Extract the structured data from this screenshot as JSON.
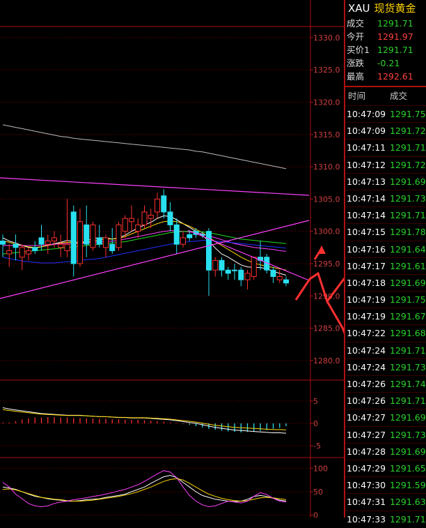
{
  "header": {
    "symbol": "XAU",
    "name": "现货黄金"
  },
  "quote": [
    {
      "label": "成交",
      "value": "1291.71",
      "color": "#2bd32b"
    },
    {
      "label": "今开",
      "value": "1291.97",
      "color": "#ff4040"
    },
    {
      "label": "买价1",
      "value": "1291.71",
      "color": "#2bd32b"
    },
    {
      "label": "涨跌",
      "value": "-0.21",
      "color": "#2bd32b"
    },
    {
      "label": "最高",
      "value": "1292.61",
      "color": "#ff4040"
    }
  ],
  "ticks_header": {
    "time": "时间",
    "price": "成交"
  },
  "ticks": [
    {
      "time": "10:47:09",
      "price": "1291.75"
    },
    {
      "time": "10:47:09",
      "price": "1291.72"
    },
    {
      "time": "10:47:11",
      "price": "1291.71"
    },
    {
      "time": "10:47:12",
      "price": "1291.72"
    },
    {
      "time": "10:47:13",
      "price": "1291.69"
    },
    {
      "time": "10:47:14",
      "price": "1291.73"
    },
    {
      "time": "10:47:14",
      "price": "1291.71"
    },
    {
      "time": "10:47:15",
      "price": "1291.78"
    },
    {
      "time": "10:47:16",
      "price": "1291.64"
    },
    {
      "time": "10:47:17",
      "price": "1291.61"
    },
    {
      "time": "10:47:18",
      "price": "1291.69"
    },
    {
      "time": "10:47:19",
      "price": "1291.75"
    },
    {
      "time": "10:47:19",
      "price": "1291.67"
    },
    {
      "time": "10:47:22",
      "price": "1291.68"
    },
    {
      "time": "10:47:24",
      "price": "1291.71"
    },
    {
      "time": "10:47:24",
      "price": "1291.73"
    },
    {
      "time": "10:47:26",
      "price": "1291.74"
    },
    {
      "time": "10:47:26",
      "price": "1291.71"
    },
    {
      "time": "10:47:27",
      "price": "1291.69"
    },
    {
      "time": "10:47:27",
      "price": "1291.73"
    },
    {
      "time": "10:47:28",
      "price": "1291.69"
    },
    {
      "time": "10:47:29",
      "price": "1291.65"
    },
    {
      "time": "10:47:30",
      "price": "1291.59"
    },
    {
      "time": "10:47:31",
      "price": "1291.63"
    },
    {
      "time": "10:47:33",
      "price": "1291.71"
    }
  ],
  "chart_data": [
    {
      "type": "candlestick",
      "y_ticks": [
        "1330.0",
        "1325.0",
        "1320.0",
        "1315.0",
        "1310.0",
        "1305.0",
        "1300.0",
        "1295.0",
        "1290.0",
        "1285.0",
        "1280.0"
      ],
      "ylim": [
        1277.5,
        1331.5
      ],
      "candles": [
        {
          "o": 1298.5,
          "h": 1299.5,
          "l": 1296.0,
          "c": 1298.0,
          "up": false
        },
        {
          "o": 1296.5,
          "h": 1298.0,
          "l": 1294.5,
          "c": 1297.0,
          "up": true
        },
        {
          "o": 1298.0,
          "h": 1299.5,
          "l": 1295.5,
          "c": 1297.5,
          "up": false
        },
        {
          "o": 1296.0,
          "h": 1298.0,
          "l": 1294.0,
          "c": 1297.5,
          "up": true
        },
        {
          "o": 1296.5,
          "h": 1297.5,
          "l": 1295.5,
          "c": 1297.0,
          "up": true
        },
        {
          "o": 1297.5,
          "h": 1298.5,
          "l": 1296.5,
          "c": 1297.0,
          "up": false
        },
        {
          "o": 1299.0,
          "h": 1301.0,
          "l": 1297.0,
          "c": 1298.0,
          "up": false
        },
        {
          "o": 1298.0,
          "h": 1299.5,
          "l": 1296.5,
          "c": 1298.5,
          "up": true
        },
        {
          "o": 1298.5,
          "h": 1300.0,
          "l": 1297.5,
          "c": 1299.0,
          "up": true
        },
        {
          "o": 1297.5,
          "h": 1299.5,
          "l": 1296.0,
          "c": 1298.0,
          "up": true
        },
        {
          "o": 1297.0,
          "h": 1305.0,
          "l": 1296.0,
          "c": 1298.0,
          "up": true
        },
        {
          "o": 1303.0,
          "h": 1304.0,
          "l": 1293.0,
          "c": 1295.0,
          "up": false
        },
        {
          "o": 1295.0,
          "h": 1303.5,
          "l": 1294.5,
          "c": 1301.5,
          "up": true
        },
        {
          "o": 1301.0,
          "h": 1304.0,
          "l": 1296.0,
          "c": 1298.0,
          "up": false
        },
        {
          "o": 1297.5,
          "h": 1301.5,
          "l": 1297.0,
          "c": 1301.0,
          "up": true
        },
        {
          "o": 1299.0,
          "h": 1301.0,
          "l": 1297.5,
          "c": 1298.0,
          "up": false
        },
        {
          "o": 1297.5,
          "h": 1299.5,
          "l": 1296.0,
          "c": 1299.0,
          "up": true
        },
        {
          "o": 1298.0,
          "h": 1300.5,
          "l": 1296.5,
          "c": 1297.0,
          "up": false
        },
        {
          "o": 1297.5,
          "h": 1301.5,
          "l": 1297.0,
          "c": 1301.0,
          "up": true
        },
        {
          "o": 1300.0,
          "h": 1302.5,
          "l": 1299.0,
          "c": 1302.0,
          "up": true
        },
        {
          "o": 1301.5,
          "h": 1304.0,
          "l": 1300.0,
          "c": 1302.0,
          "up": true
        },
        {
          "o": 1300.0,
          "h": 1302.0,
          "l": 1299.0,
          "c": 1301.0,
          "up": true
        },
        {
          "o": 1301.0,
          "h": 1304.0,
          "l": 1300.5,
          "c": 1303.0,
          "up": true
        },
        {
          "o": 1302.0,
          "h": 1303.5,
          "l": 1300.5,
          "c": 1302.5,
          "up": true
        },
        {
          "o": 1303.0,
          "h": 1306.0,
          "l": 1302.0,
          "c": 1305.0,
          "up": true
        },
        {
          "o": 1305.5,
          "h": 1306.5,
          "l": 1302.0,
          "c": 1303.0,
          "up": false
        },
        {
          "o": 1303.0,
          "h": 1304.5,
          "l": 1300.0,
          "c": 1301.0,
          "up": false
        },
        {
          "o": 1301.0,
          "h": 1302.0,
          "l": 1296.5,
          "c": 1298.0,
          "up": false
        },
        {
          "o": 1298.0,
          "h": 1300.0,
          "l": 1297.5,
          "c": 1299.0,
          "up": true
        },
        {
          "o": 1299.0,
          "h": 1300.0,
          "l": 1298.5,
          "c": 1299.5,
          "up": false
        },
        {
          "o": 1300.0,
          "h": 1300.5,
          "l": 1299.0,
          "c": 1299.5,
          "up": false
        },
        {
          "o": 1299.5,
          "h": 1300.0,
          "l": 1299.0,
          "c": 1299.5,
          "up": false
        },
        {
          "o": 1300.0,
          "h": 1300.5,
          "l": 1290.0,
          "c": 1294.0,
          "up": false
        },
        {
          "o": 1294.0,
          "h": 1296.0,
          "l": 1293.0,
          "c": 1295.5,
          "up": true
        },
        {
          "o": 1295.5,
          "h": 1296.0,
          "l": 1293.0,
          "c": 1294.0,
          "up": false
        },
        {
          "o": 1294.0,
          "h": 1294.5,
          "l": 1292.5,
          "c": 1293.5,
          "up": false
        },
        {
          "o": 1294.0,
          "h": 1295.0,
          "l": 1292.5,
          "c": 1294.0,
          "up": false
        },
        {
          "o": 1294.0,
          "h": 1294.5,
          "l": 1291.5,
          "c": 1292.5,
          "up": false
        },
        {
          "o": 1292.5,
          "h": 1294.0,
          "l": 1291.0,
          "c": 1293.5,
          "up": true
        },
        {
          "o": 1293.0,
          "h": 1296.0,
          "l": 1292.5,
          "c": 1296.0,
          "up": true
        },
        {
          "o": 1296.0,
          "h": 1298.5,
          "l": 1294.0,
          "c": 1295.5,
          "up": false
        },
        {
          "o": 1296.0,
          "h": 1296.5,
          "l": 1293.5,
          "c": 1294.0,
          "up": false
        },
        {
          "o": 1294.0,
          "h": 1294.5,
          "l": 1292.0,
          "c": 1293.0,
          "up": false
        },
        {
          "o": 1293.0,
          "h": 1294.0,
          "l": 1292.0,
          "c": 1292.5,
          "up": true
        },
        {
          "o": 1292.5,
          "h": 1293.0,
          "l": 1291.5,
          "c": 1292.0,
          "up": false
        }
      ],
      "ma_series": [
        {
          "color": "#ffffff",
          "values": [
            1299.0,
            1298.5,
            1298.2,
            1297.8,
            1297.5,
            1297.4,
            1297.6,
            1297.8,
            1298.1,
            1298.3,
            1298.6,
            1298.4,
            1298.2,
            1298.5,
            1298.9,
            1299.0,
            1299.0,
            1298.8,
            1299.0,
            1299.4,
            1300.0,
            1300.5,
            1301.0,
            1301.4,
            1302.0,
            1302.4,
            1302.3,
            1301.8,
            1301.2,
            1300.6,
            1300.0,
            1299.4,
            1298.5,
            1297.4,
            1296.5,
            1296.0,
            1295.4,
            1294.8,
            1294.5,
            1294.4,
            1294.4,
            1294.2,
            1293.8,
            1293.5,
            1293.2
          ]
        },
        {
          "color": "#ffd800",
          "values": [
            1298.5,
            1298.3,
            1298.0,
            1297.8,
            1297.6,
            1297.5,
            1297.6,
            1297.8,
            1298.0,
            1298.2,
            1298.3,
            1298.3,
            1298.2,
            1298.3,
            1298.5,
            1298.7,
            1298.8,
            1298.8,
            1298.9,
            1299.2,
            1299.6,
            1300.0,
            1300.4,
            1300.8,
            1301.2,
            1301.5,
            1301.6,
            1301.5,
            1301.2,
            1300.8,
            1300.3,
            1299.8,
            1299.1,
            1298.4,
            1297.8,
            1297.2,
            1296.6,
            1296.0,
            1295.5,
            1295.1,
            1294.8,
            1294.6,
            1294.4,
            1294.2,
            1294.0
          ]
        },
        {
          "color": "#ff40ff",
          "values": [
            1297.8,
            1297.8,
            1297.8,
            1297.8,
            1297.8,
            1297.8,
            1297.8,
            1297.9,
            1298.0,
            1298.1,
            1298.1,
            1298.1,
            1298.1,
            1298.2,
            1298.3,
            1298.4,
            1298.4,
            1298.5,
            1298.6,
            1298.8,
            1299.0,
            1299.2,
            1299.4,
            1299.6,
            1299.8,
            1300.0,
            1300.1,
            1300.1,
            1300.0,
            1299.9,
            1299.8,
            1299.6,
            1299.3,
            1299.0,
            1298.7,
            1298.4,
            1298.1,
            1297.9,
            1297.7,
            1297.5,
            1297.4,
            1297.3,
            1297.2,
            1297.0,
            1296.9
          ]
        },
        {
          "color": "#20e020",
          "values": [
            1296.5,
            1296.6,
            1296.7,
            1296.8,
            1296.9,
            1297.0,
            1297.1,
            1297.2,
            1297.3,
            1297.4,
            1297.5,
            1297.6,
            1297.7,
            1297.8,
            1297.9,
            1298.0,
            1298.1,
            1298.2,
            1298.3,
            1298.4,
            1298.6,
            1298.8,
            1299.0,
            1299.2,
            1299.4,
            1299.6,
            1299.8,
            1299.9,
            1300.0,
            1300.0,
            1300.0,
            1299.9,
            1299.8,
            1299.6,
            1299.4,
            1299.2,
            1299.0,
            1298.8,
            1298.7,
            1298.6,
            1298.5,
            1298.4,
            1298.3,
            1298.2,
            1298.1
          ]
        },
        {
          "color": "#2030ff",
          "values": [
            1296.0,
            1295.8,
            1295.6,
            1295.4,
            1295.3,
            1295.2,
            1295.1,
            1295.1,
            1295.1,
            1295.2,
            1295.3,
            1295.4,
            1295.5,
            1295.6,
            1295.7,
            1295.8,
            1296.0,
            1296.2,
            1296.4,
            1296.6,
            1296.8,
            1297.0,
            1297.2,
            1297.4,
            1297.6,
            1297.8,
            1298.0,
            1298.2,
            1298.3,
            1298.4,
            1298.5,
            1298.6,
            1298.6,
            1298.5,
            1298.4,
            1298.3,
            1298.2,
            1298.1,
            1298.0,
            1297.9,
            1297.8,
            1297.7,
            1297.6,
            1297.5,
            1297.4
          ]
        },
        {
          "color": "#bbbbbb",
          "values": [
            1316.5,
            1316.3,
            1316.1,
            1315.9,
            1315.7,
            1315.5,
            1315.3,
            1315.1,
            1314.9,
            1314.7,
            1314.6,
            1314.4,
            1314.3,
            1314.2,
            1314.1,
            1314.0,
            1313.9,
            1313.8,
            1313.7,
            1313.6,
            1313.5,
            1313.4,
            1313.3,
            1313.2,
            1313.1,
            1313.0,
            1312.9,
            1312.8,
            1312.7,
            1312.6,
            1312.4,
            1312.3,
            1312.1,
            1311.9,
            1311.7,
            1311.5,
            1311.3,
            1311.1,
            1310.9,
            1310.7,
            1310.5,
            1310.3,
            1310.1,
            1309.9,
            1309.7
          ]
        }
      ]
    },
    {
      "type": "bar",
      "y_ticks": [
        "5",
        "0",
        "-5"
      ],
      "ylim": [
        -7,
        7
      ],
      "values": [
        0.2,
        0.2,
        0.5,
        0.9,
        1.1,
        1.3,
        1.3,
        1.4,
        1.4,
        1.3,
        1.3,
        1.2,
        1.2,
        1.1,
        1.1,
        1.0,
        1.0,
        0.9,
        0.9,
        0.8,
        0.8,
        0.8,
        0.7,
        0.6,
        0.5,
        0.4,
        0.2,
        0.1,
        -0.1,
        -0.3,
        -0.6,
        -0.9,
        -1.2,
        -1.4,
        -1.6,
        -1.8,
        -1.9,
        -2.0,
        -1.9,
        -1.8,
        -1.7,
        -1.5,
        -1.2,
        -1.0,
        -0.6
      ]
    },
    {
      "type": "line",
      "y_ticks": [
        "100",
        "50",
        "0"
      ],
      "ylim": [
        -5,
        105
      ],
      "series": [
        {
          "color": "#ffffff",
          "values": [
            60,
            58,
            55,
            50,
            45,
            40,
            38,
            35,
            33,
            32,
            30,
            30,
            31,
            33,
            34,
            35,
            38,
            40,
            42,
            45,
            50,
            55,
            60,
            68,
            75,
            82,
            85,
            80,
            70,
            60,
            50,
            42,
            38,
            34,
            32,
            30,
            29,
            30,
            34,
            40,
            42,
            40,
            36,
            32,
            30
          ]
        },
        {
          "color": "#ffd800",
          "values": [
            55,
            56,
            54,
            50,
            46,
            42,
            38,
            36,
            34,
            33,
            31,
            30,
            30,
            31,
            32,
            34,
            36,
            38,
            40,
            43,
            46,
            50,
            55,
            60,
            66,
            72,
            76,
            78,
            75,
            68,
            60,
            52,
            45,
            40,
            36,
            33,
            31,
            30,
            31,
            34,
            37,
            38,
            37,
            35,
            33
          ]
        },
        {
          "color": "#ff40ff",
          "values": [
            70,
            60,
            45,
            35,
            25,
            20,
            18,
            20,
            25,
            28,
            30,
            33,
            35,
            37,
            40,
            42,
            45,
            48,
            52,
            55,
            60,
            65,
            72,
            80,
            88,
            95,
            92,
            80,
            60,
            42,
            30,
            22,
            18,
            20,
            25,
            30,
            28,
            26,
            30,
            40,
            48,
            44,
            36,
            30,
            28
          ]
        }
      ]
    }
  ]
}
